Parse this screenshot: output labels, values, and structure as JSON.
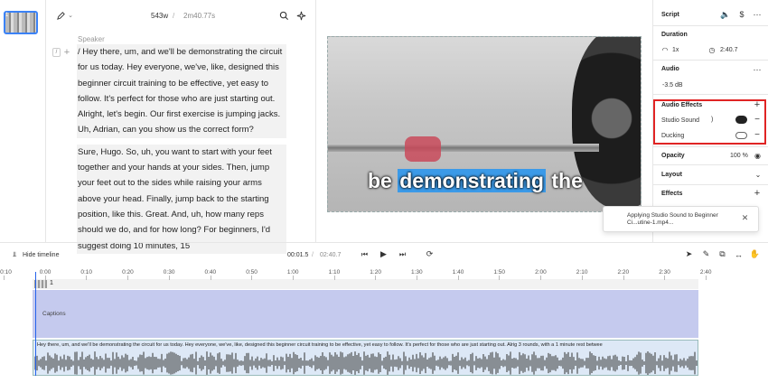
{
  "editor": {
    "word_count": "543w",
    "separator": "/",
    "duration": "2m40.77s",
    "speaker": "Speaker",
    "paragraphs": [
      "/ Hey there, um, and we'll be demonstrating the circuit for us today. Hey everyone, we've, like, designed this beginner circuit training to be effective, yet easy to follow. It's perfect for those who are just starting out. Alright, let's begin. Our first exercise is jumping jacks. Uh, Adrian, can you show us the correct form?",
      "Sure, Hugo. So, uh, you want to start with your feet together and your hands at your sides. Then, jump your feet out to the sides while raising your arms above your head. Finally, jump back to the starting position, like this. Great. And, uh, how many reps should we do, and for how long? For beginners, I'd suggest doing 10 minutes, 15"
    ]
  },
  "preview": {
    "caption_before": "be",
    "caption_highlight": "demonstrating",
    "caption_after": "the"
  },
  "properties": {
    "script_label": "Script",
    "duration_label": "Duration",
    "speed": "1x",
    "duration_value": "2:40.7",
    "audio_label": "Audio",
    "volume": "-3.5 dB",
    "audio_effects_label": "Audio Effects",
    "studio_sound_label": "Studio Sound",
    "ducking_label": "Ducking",
    "opacity_label": "Opacity",
    "opacity_value": "100 %",
    "layout_label": "Layout",
    "effects_label": "Effects"
  },
  "toast": {
    "text_line1": "Applying Studio Sound to Beginner",
    "text_line2": "Ci...utine-1.mp4..."
  },
  "timeline": {
    "hide_label": "Hide timeline",
    "current_time": "00:01.5",
    "separator": "/",
    "total_time": "02:40.7",
    "ticks": [
      "-0:10",
      "0:00",
      "0:10",
      "0:20",
      "0:30",
      "0:40",
      "0:50",
      "1:00",
      "1:10",
      "1:20",
      "1:30",
      "1:40",
      "1:50",
      "2:00",
      "2:10",
      "2:20",
      "2:30",
      "2:40"
    ],
    "scene_label": "1",
    "captions_label": "Captions",
    "audio_text": "Hey there, um, and we'll be demonstrating the circuit for us today. Hey everyone, we've, like, designed this beginner circuit training to be effective, yet easy to follow. It's perfect for those who are just starting out. Alrig  3 rounds, with a 1 minute rest betwee"
  },
  "colors": {
    "accent": "#3b82f6",
    "captions_track": "#c5caee",
    "audio_track": "#dde8f6",
    "highlight_box": "#e02424"
  }
}
